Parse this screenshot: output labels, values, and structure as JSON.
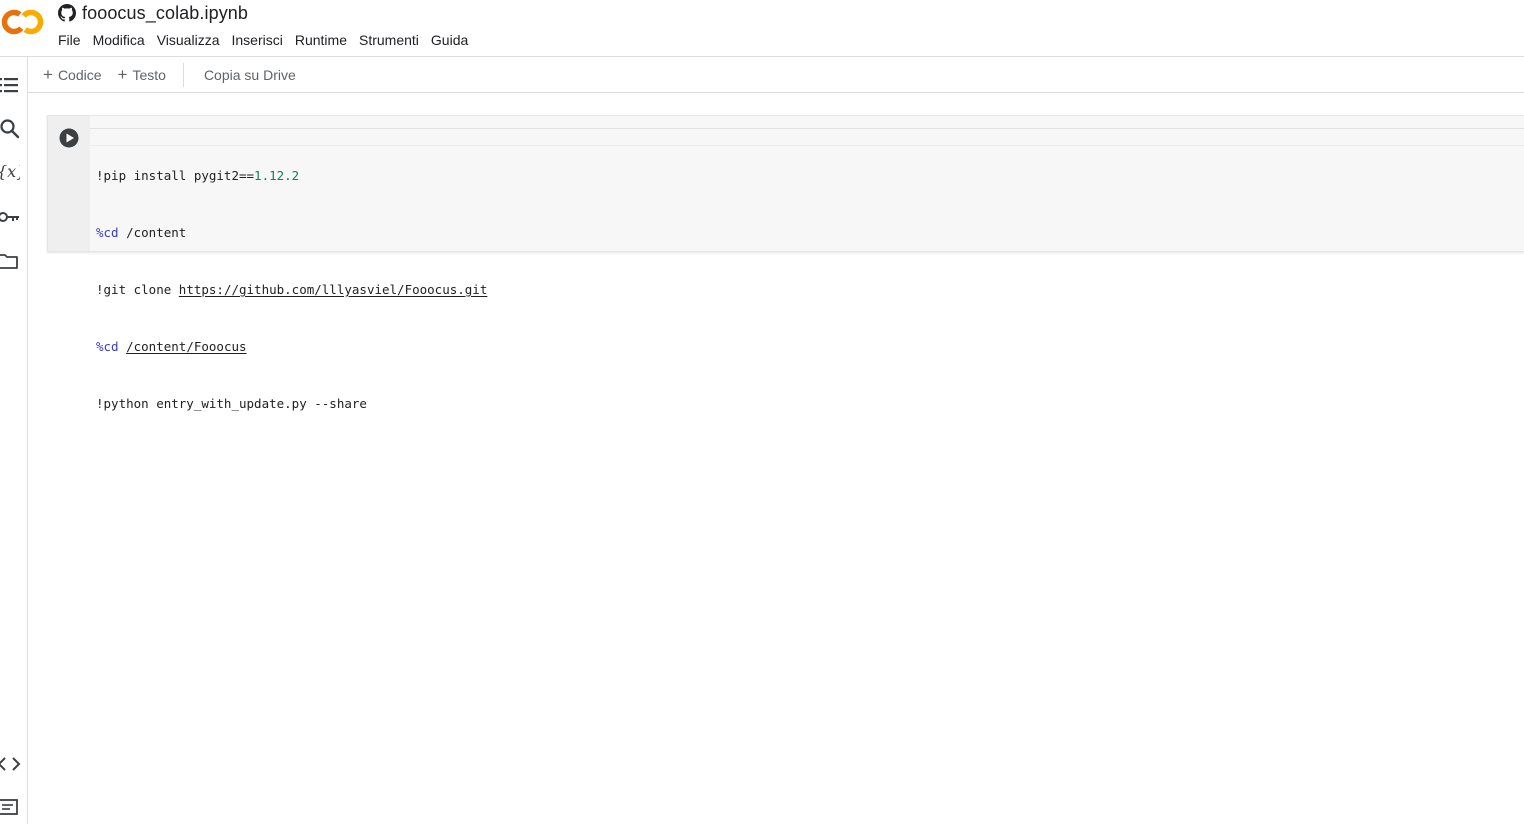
{
  "header": {
    "title": "fooocus_colab.ipynb",
    "logo_icon": "colab-logo-icon",
    "source_icon": "github-icon"
  },
  "menu": {
    "items": [
      {
        "label": "File"
      },
      {
        "label": "Modifica"
      },
      {
        "label": "Visualizza"
      },
      {
        "label": "Inserisci"
      },
      {
        "label": "Runtime"
      },
      {
        "label": "Strumenti"
      },
      {
        "label": "Guida"
      }
    ]
  },
  "left_rail": {
    "icons": [
      "table-of-contents-icon",
      "search-icon",
      "variables-icon",
      "secrets-key-icon",
      "files-folder-icon",
      "code-snippets-icon",
      "command-palette-icon"
    ]
  },
  "toolbar": {
    "add_code_label": "Codice",
    "add_text_label": "Testo",
    "copy_to_drive_label": "Copia su Drive"
  },
  "cell": {
    "lines": [
      {
        "prefix": "!pip install pygit2==",
        "value": "1.12.2"
      },
      {
        "magic": "%cd",
        "rest": " /content"
      },
      {
        "prefix": "!git clone ",
        "link": "https://github.com/lllyasviel/Fooocus.git"
      },
      {
        "magic": "%cd",
        "space": " ",
        "link": "/content/Fooocus"
      },
      {
        "prefix": "!python entry_with_update.py --share"
      }
    ]
  },
  "colors": {
    "logo_orange": "#F9AB00",
    "logo_dark_orange": "#E8710A",
    "number_green": "#098658",
    "magic_blue": "#3A3ACC"
  }
}
